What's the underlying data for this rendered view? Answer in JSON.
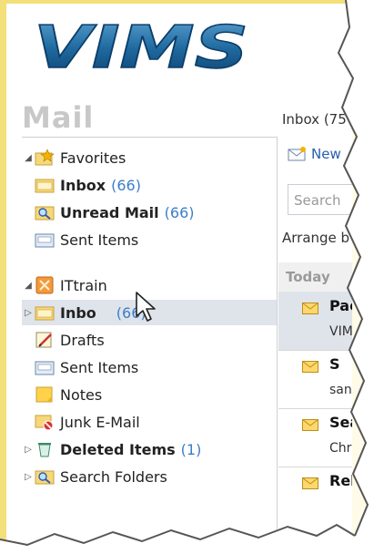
{
  "logo": {
    "text": "VIMS"
  },
  "header": {
    "title": "Mail"
  },
  "nav": {
    "favorites": {
      "label": "Favorites",
      "items": [
        {
          "label": "Inbox",
          "count": "(66)"
        },
        {
          "label": "Unread Mail",
          "count": "(66)"
        },
        {
          "label": "Sent Items"
        }
      ]
    },
    "account": {
      "label": "ITtrain",
      "items": [
        {
          "label": "Inbo",
          "count": "(66)"
        },
        {
          "label": "Drafts"
        },
        {
          "label": "Sent Items"
        },
        {
          "label": "Notes"
        },
        {
          "label": "Junk E-Mail"
        },
        {
          "label": "Deleted Items",
          "count": "(1)"
        },
        {
          "label": "Search Folders"
        }
      ]
    }
  },
  "list": {
    "header": "Inbox (75",
    "new_label": "New",
    "search_placeholder": "Search",
    "arrange": "Arrange b",
    "group": "Today",
    "messages": [
      {
        "from": "Pac",
        "snippet": "VIMS"
      },
      {
        "from": "S",
        "snippet": "sand"
      },
      {
        "from": "Seat",
        "snippet": "Chris"
      },
      {
        "from": "Rel",
        "snippet": ""
      }
    ]
  },
  "colors": {
    "frame": "#f3e07a",
    "selection": "#dfe3ea",
    "count": "#3b7ec7",
    "logo": "#1f6aa0"
  }
}
